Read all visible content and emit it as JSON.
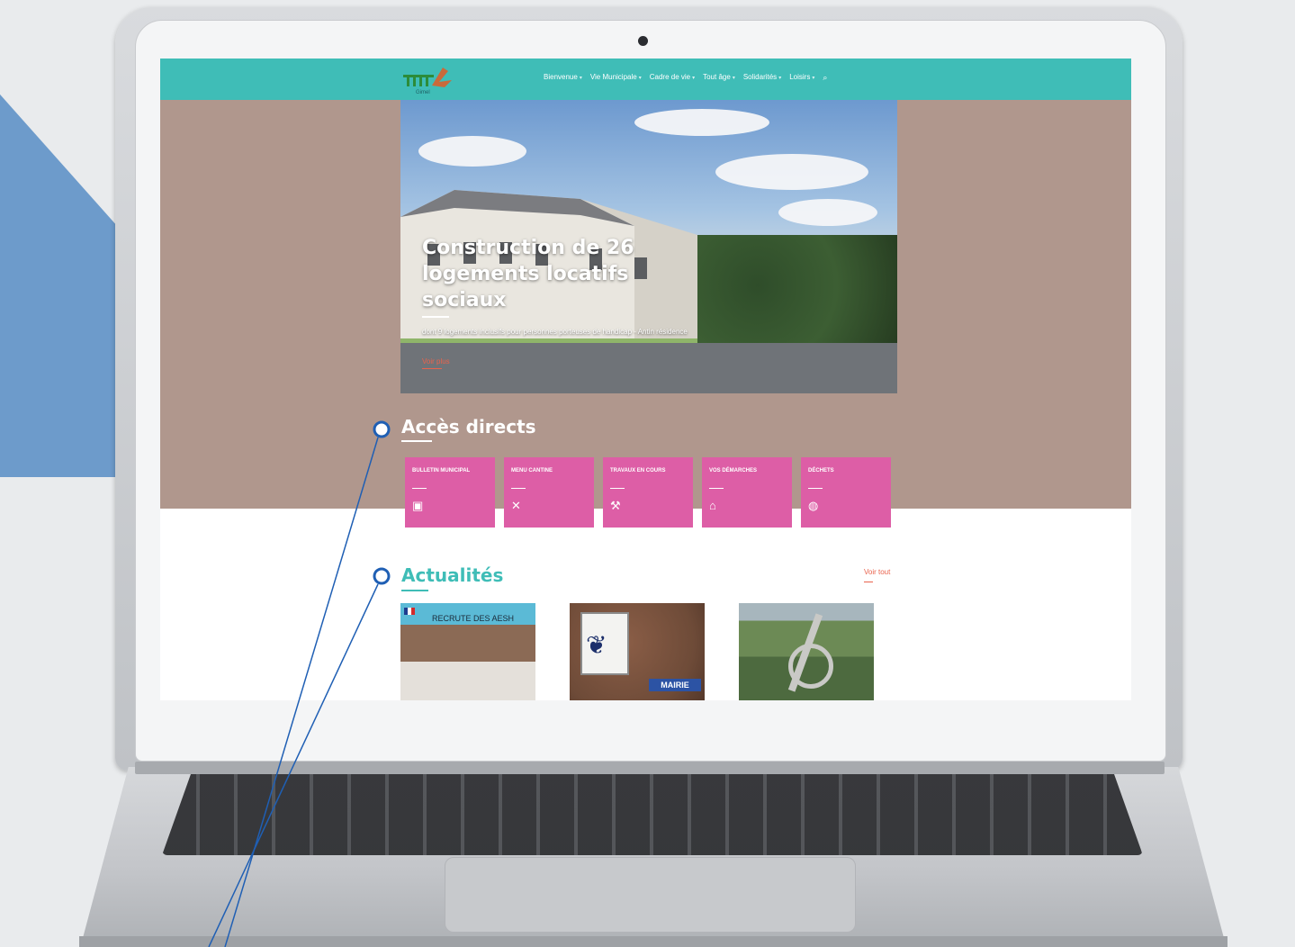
{
  "site": {
    "logo_alt": "Gimel",
    "nav": [
      {
        "label": "Bienvenue"
      },
      {
        "label": "Vie Municipale"
      },
      {
        "label": "Cadre de vie"
      },
      {
        "label": "Tout âge"
      },
      {
        "label": "Solidarités"
      },
      {
        "label": "Loisirs"
      }
    ],
    "search_icon": "search-icon"
  },
  "hero": {
    "title": "Construction de 26 logements locatifs sociaux",
    "description": "dont 9 logements inclusifs pour personnes porteuses de handicap - Antin résidence",
    "more_label": "Voir plus"
  },
  "acces_directs": {
    "title": "Accès directs",
    "tiles": [
      {
        "label": "Bulletin municipal",
        "icon": "book-icon"
      },
      {
        "label": "Menu cantine",
        "icon": "utensils-icon"
      },
      {
        "label": "Travaux en cours",
        "icon": "wrench-icon"
      },
      {
        "label": "Vos démarches",
        "icon": "institution-icon"
      },
      {
        "label": "Déchets",
        "icon": "globe-icon"
      }
    ]
  },
  "actualites": {
    "title": "Actualités",
    "see_all": "Voir tout",
    "items": [
      {
        "caption": "RECRUTE DES AESH"
      },
      {
        "caption": "MAIRIE"
      },
      {
        "caption": ""
      }
    ]
  },
  "colors": {
    "nav_bg": "#3fbdb7",
    "page_bg": "#b0978d",
    "tile_bg": "#dd5ea6",
    "accent_link": "#e9634d",
    "annotation": "#1f5fb4"
  }
}
